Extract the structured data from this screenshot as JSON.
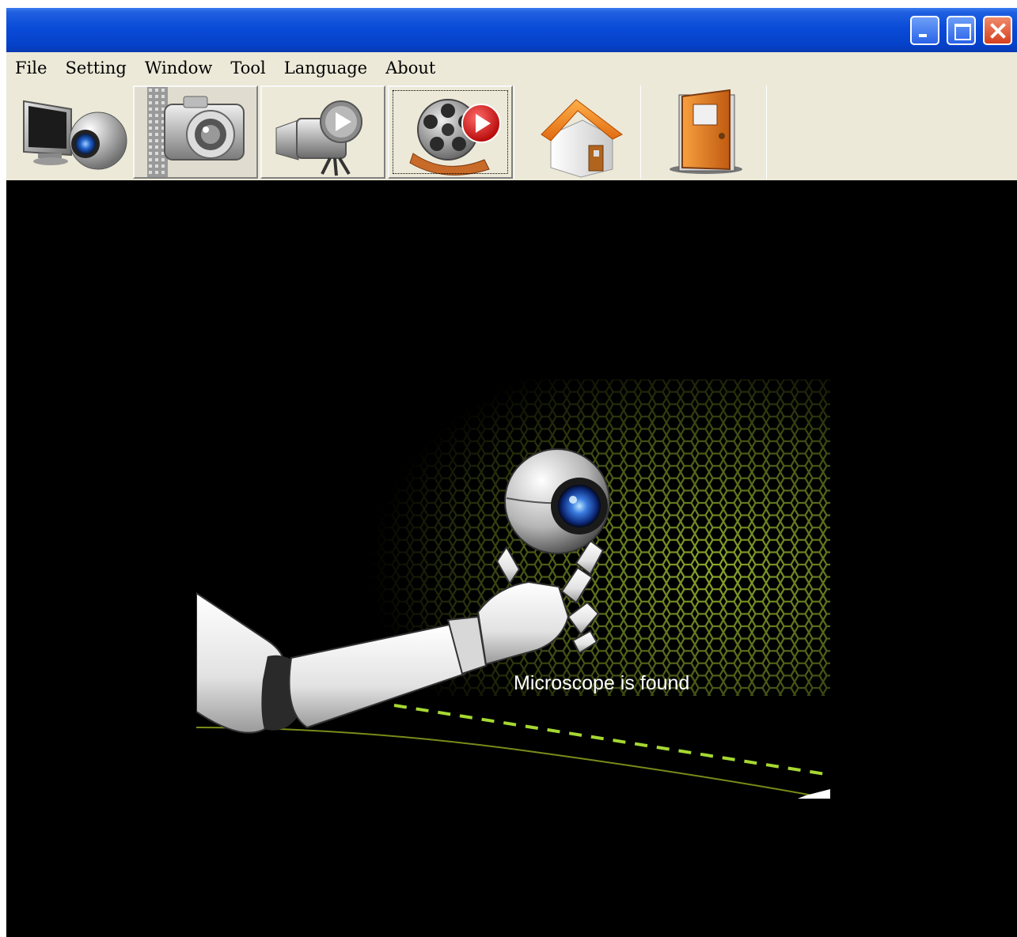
{
  "window": {
    "title": ""
  },
  "menu": [
    "File",
    "Setting",
    "Window",
    "Tool",
    "Language",
    "About"
  ],
  "toolbar": {
    "buttons": [
      {
        "name": "microscope",
        "icon": "monitor-camera-icon"
      },
      {
        "name": "snapshot",
        "icon": "camera-icon"
      },
      {
        "name": "record",
        "icon": "video-camera-icon"
      },
      {
        "name": "playback",
        "icon": "film-reel-icon"
      },
      {
        "name": "home",
        "icon": "house-icon"
      },
      {
        "name": "exit",
        "icon": "door-icon"
      }
    ]
  },
  "main": {
    "status": "Microscope is found"
  },
  "colors": {
    "titlebar": "#0a4bd8",
    "menubar": "#ece9d8",
    "stage": "#000000",
    "accent": "#a6c832"
  }
}
